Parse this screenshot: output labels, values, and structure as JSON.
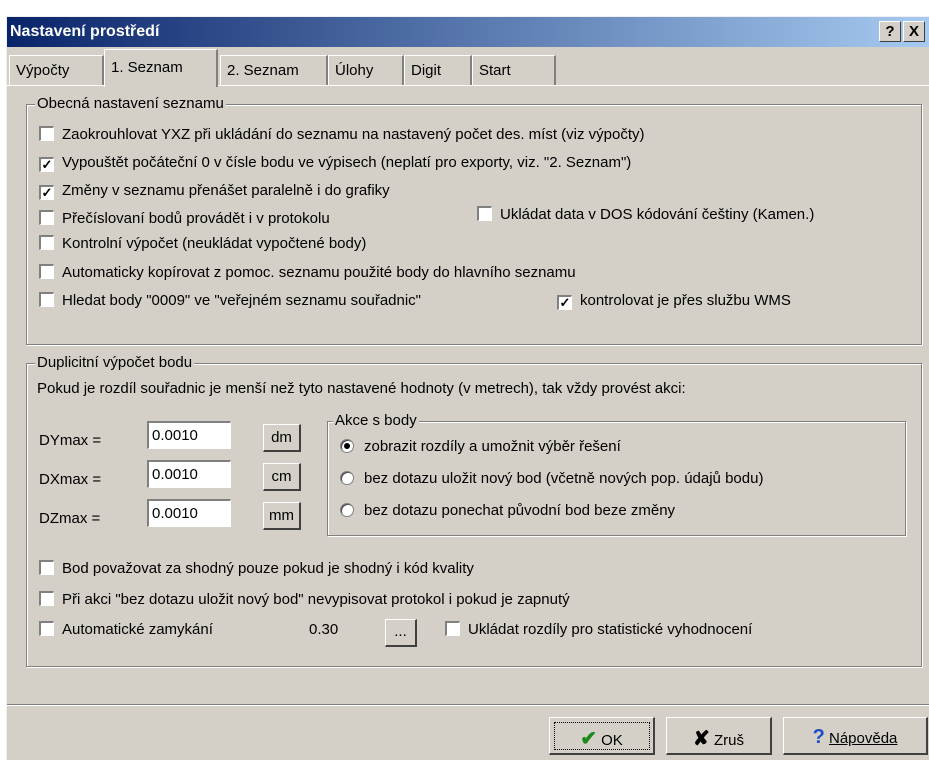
{
  "window": {
    "title": "Nastavení prostředí",
    "help_glyph": "?",
    "close_glyph": "X"
  },
  "tabs": [
    {
      "label": "Výpočty"
    },
    {
      "label": "1. Seznam"
    },
    {
      "label": "2. Seznam"
    },
    {
      "label": "Úlohy"
    },
    {
      "label": "Digit"
    },
    {
      "label": "Start"
    }
  ],
  "general": {
    "legend": "Obecná nastavení seznamu",
    "round": {
      "label": "Zaokrouhlovat YXZ při ukládání do seznamu na nastavený počet des. míst (viz výpočty)",
      "checked": false
    },
    "omit_zero": {
      "label": "Vypouštět počáteční 0 v čísle bodu ve výpisech (neplatí pro exporty, viz. \"2. Seznam\")",
      "checked": true
    },
    "parallel": {
      "label": "Změny v seznamu přenášet paralelně i do grafiky",
      "checked": true
    },
    "renumber": {
      "label": "Přečíslovaní bodů provádět i v protokolu",
      "checked": false
    },
    "dos": {
      "label": "Ukládat data v DOS kódování češtiny (Kamen.)",
      "checked": false
    },
    "control": {
      "label": "Kontrolní výpočet (neukládat vypočtené body)",
      "checked": false
    },
    "autocopy": {
      "label": "Automaticky kopírovat z pomoc. seznamu použité body do hlavního seznamu",
      "checked": false
    },
    "search": {
      "label": "Hledat body \"0009\" ve \"veřejném seznamu souřadnic\"",
      "checked": false
    },
    "wms": {
      "label": "kontrolovat je přes službu WMS",
      "checked": true
    }
  },
  "duplicate": {
    "legend": "Duplicitní výpočet bodu",
    "intro": "Pokud je rozdíl souřadnic je menší než tyto nastavené hodnoty (v metrech), tak vždy provést akci:",
    "dy": {
      "label": "DYmax =",
      "value": "0.0010",
      "unit": "dm"
    },
    "dx": {
      "label": "DXmax =",
      "value": "0.0010",
      "unit": "cm"
    },
    "dz": {
      "label": "DZmax =",
      "value": "0.0010",
      "unit": "mm"
    },
    "actions": {
      "legend": "Akce s body",
      "options": [
        {
          "label": "zobrazit rozdíly a umožnit výběr řešení",
          "selected": true
        },
        {
          "label": "bez dotazu uložit nový bod (včetně nových pop. údajů bodu)",
          "selected": false
        },
        {
          "label": "bez dotazu ponechat původní bod beze změny",
          "selected": false
        }
      ]
    },
    "quality": {
      "label": "Bod považovat za shodný pouze pokud je shodný i kód kvality",
      "checked": false
    },
    "noprotocol": {
      "label": "Při akci \"bez dotazu uložit nový bod\" nevypisovat protokol i pokud je zapnutý",
      "checked": false
    },
    "autolock": {
      "label": "Automatické zamykání",
      "value": "0.30",
      "button": "...",
      "checked": false
    },
    "stats": {
      "label": "Ukládat rozdíly pro statistické vyhodnocení",
      "checked": false
    }
  },
  "buttons": {
    "ok": "OK",
    "cancel": "Zruš",
    "help": "Nápověda"
  }
}
